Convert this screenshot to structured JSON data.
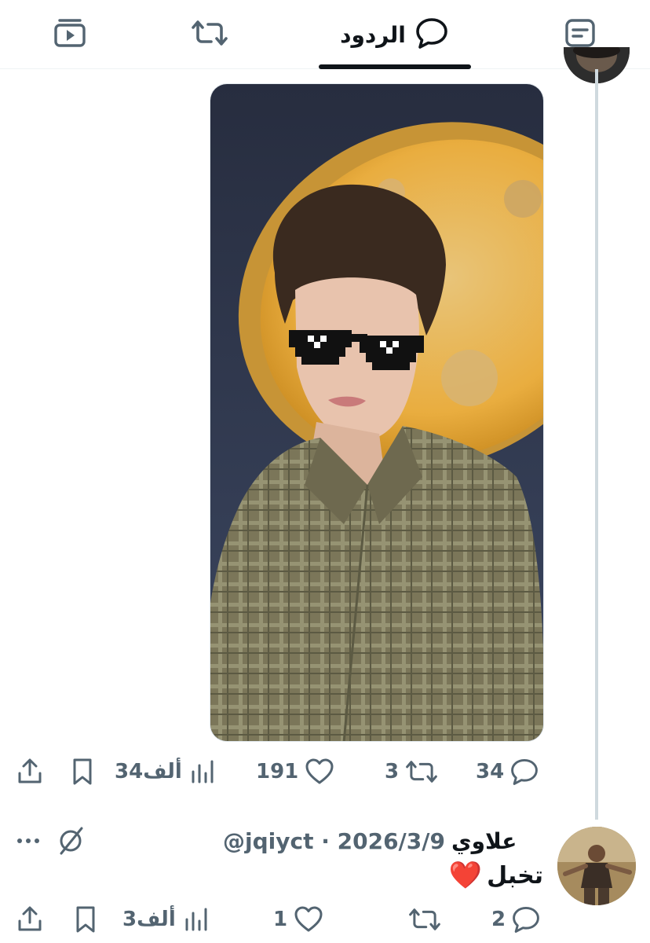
{
  "tabs": {
    "video_icon": "video-icon",
    "repost_icon": "repost-icon",
    "replies_label": "الردود",
    "replies_icon": "reply-bubble-icon",
    "articles_icon": "article-icon"
  },
  "post": {
    "media_icon": "photo",
    "actions": {
      "replies": "34",
      "reposts": "3",
      "likes": "191",
      "views": "34ألف"
    }
  },
  "reply": {
    "name": "علاوي",
    "handle": "@jqiyct",
    "separator": "·",
    "date": "2026/3/9",
    "text": "تخبل",
    "emoji": "❤️",
    "actions": {
      "replies": "2",
      "reposts": "",
      "likes": "1",
      "views": "3ألف"
    }
  },
  "colors": {
    "text_primary": "#0f1419",
    "text_secondary": "#536471",
    "thread_line": "#cfd9de"
  }
}
